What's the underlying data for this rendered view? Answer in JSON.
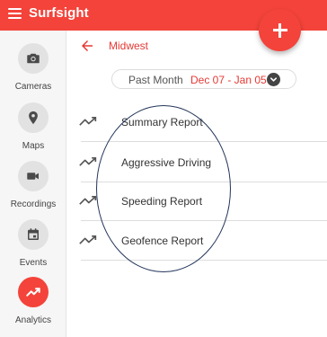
{
  "app": {
    "brand": "Surfsight"
  },
  "sidebar": {
    "items": [
      {
        "label": "Cameras",
        "icon": "camera-icon"
      },
      {
        "label": "Maps",
        "icon": "map-pin-icon"
      },
      {
        "label": "Recordings",
        "icon": "video-camera-icon"
      },
      {
        "label": "Events",
        "icon": "calendar-icon"
      },
      {
        "label": "Analytics",
        "icon": "trending-icon",
        "active": true
      }
    ]
  },
  "header": {
    "title": "Midwest"
  },
  "date_filter": {
    "label": "Past Month",
    "range": "Dec 07 - Jan 05"
  },
  "reports": [
    {
      "label": "Summary Report",
      "icon": "trending-icon"
    },
    {
      "label": "Aggressive Driving",
      "icon": "trending-icon"
    },
    {
      "label": "Speeding Report",
      "icon": "trending-icon"
    },
    {
      "label": "Geofence Report",
      "icon": "trending-icon"
    }
  ],
  "colors": {
    "brand": "#f4433a",
    "accent_text": "#e53935",
    "annotation": "#23355a"
  }
}
